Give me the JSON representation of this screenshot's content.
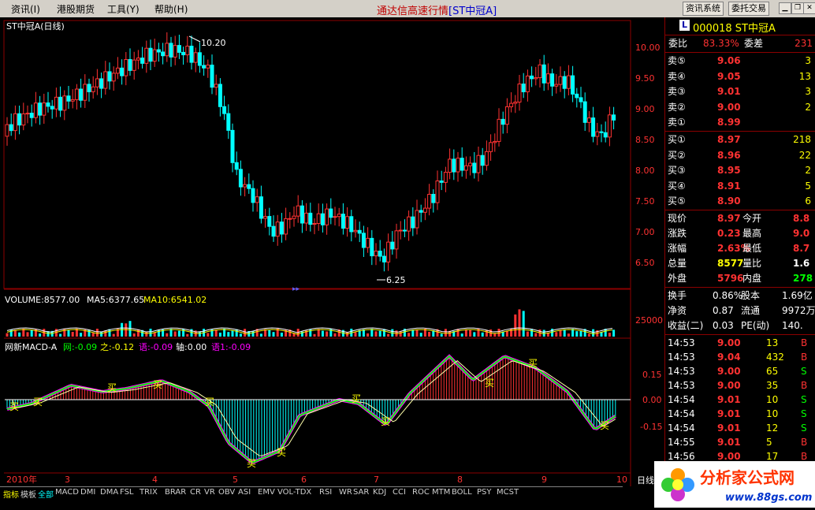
{
  "menu": {
    "items": [
      "资讯(I)",
      "港股期货",
      "工具(Y)",
      "帮助(H)"
    ],
    "title": "通达信高速行情",
    "title_sub": "[ST中冠A]",
    "btn_info": "资讯系统",
    "btn_trade": "委托交易"
  },
  "chart": {
    "main_title": "ST中冠A(日线)",
    "high_label": "10.20",
    "low_label": "6.25",
    "y_ticks": [
      "10.00",
      "9.50",
      "9.00",
      "8.50",
      "8.00",
      "7.50",
      "7.00",
      "6.50"
    ],
    "volume_label": "VOLUME:8577.00",
    "ma5_label": "MA5:6377.65",
    "ma10_label": "MA10:6541.02",
    "vol_tick": "25000",
    "macd_label": "网新MACD-A",
    "macd_w": "网:-0.09",
    "macd_z": "之:-0.12",
    "macd_y": "语:-0.09",
    "macd_zhou": "轴:0.00",
    "macd_y1": "语1:-0.09",
    "macd_ticks": [
      "0.15",
      "0.00",
      "-0.15"
    ],
    "buy_mark": "买",
    "x_labels": [
      "2010年",
      "3",
      "4",
      "5",
      "6",
      "7",
      "8",
      "9",
      "10"
    ],
    "period": "日线"
  },
  "panel": {
    "logo": "L",
    "code": "000018 ST中冠A",
    "weibi_label": "委比",
    "weibi_val": "83.33%",
    "weicha_label": "委差",
    "weicha_val": "231",
    "asks": [
      {
        "label": "卖⑤",
        "price": "9.06",
        "vol": "3"
      },
      {
        "label": "卖④",
        "price": "9.05",
        "vol": "13"
      },
      {
        "label": "卖③",
        "price": "9.01",
        "vol": "3"
      },
      {
        "label": "卖②",
        "price": "9.00",
        "vol": "2"
      },
      {
        "label": "卖①",
        "price": "8.99",
        "vol": ""
      }
    ],
    "bids": [
      {
        "label": "买①",
        "price": "8.97",
        "vol": "218"
      },
      {
        "label": "买②",
        "price": "8.96",
        "vol": "22"
      },
      {
        "label": "买③",
        "price": "8.95",
        "vol": "2"
      },
      {
        "label": "买④",
        "price": "8.91",
        "vol": "5"
      },
      {
        "label": "买⑤",
        "price": "8.90",
        "vol": "6"
      }
    ],
    "stats": [
      {
        "l1": "现价",
        "v1": "8.97",
        "l2": "今开",
        "v2": "8.8"
      },
      {
        "l1": "涨跌",
        "v1": "0.23",
        "l2": "最高",
        "v2": "9.0"
      },
      {
        "l1": "涨幅",
        "v1": "2.63%",
        "l2": "最低",
        "v2": "8.7"
      },
      {
        "l1": "总量",
        "v1": "8577",
        "l2": "量比",
        "v2": "1.6"
      },
      {
        "l1": "外盘",
        "v1": "5796",
        "l2": "内盘",
        "v2": "278"
      }
    ],
    "stats2": [
      {
        "l1": "换手",
        "v1": "0.86%",
        "l2": "股本",
        "v2": "1.69亿"
      },
      {
        "l1": "净资",
        "v1": "0.87",
        "l2": "流通",
        "v2": "9972万"
      },
      {
        "l1": "收益(二)",
        "v1": "0.03",
        "l2": "PE(动)",
        "v2": "140."
      }
    ],
    "ticks": [
      {
        "t": "14:53",
        "p": "9.00",
        "v": "13",
        "d": "B"
      },
      {
        "t": "14:53",
        "p": "9.04",
        "v": "432",
        "d": "B"
      },
      {
        "t": "14:53",
        "p": "9.00",
        "v": "65",
        "d": "S"
      },
      {
        "t": "14:53",
        "p": "9.00",
        "v": "35",
        "d": "B"
      },
      {
        "t": "14:54",
        "p": "9.01",
        "v": "10",
        "d": "S"
      },
      {
        "t": "14:54",
        "p": "9.01",
        "v": "10",
        "d": "S"
      },
      {
        "t": "14:54",
        "p": "9.01",
        "v": "12",
        "d": "S"
      },
      {
        "t": "14:55",
        "p": "9.01",
        "v": "5",
        "d": "B"
      },
      {
        "t": "14:56",
        "p": "9.00",
        "v": "17",
        "d": "B"
      }
    ]
  },
  "tabs": [
    "指标",
    "模板",
    "全部",
    "MACD",
    "DMI",
    "DMA",
    "FSL",
    "TRIX",
    "BRAR",
    "CR",
    "VR",
    "OBV",
    "ASI",
    "EMV",
    "VOL-TDX",
    "RSI",
    "WR",
    "SAR",
    "KDJ",
    "CCI",
    "ROC",
    "MTM",
    "BOLL",
    "PSY",
    "MCST"
  ],
  "brand": {
    "name": "分析家公式网",
    "url": "www.88gs.com"
  },
  "colors": {
    "up": "#ff3232",
    "down": "#00ffff",
    "grid": "#8b0000",
    "macd_up": "#ff00ff",
    "macd_down": "#00ff00"
  }
}
